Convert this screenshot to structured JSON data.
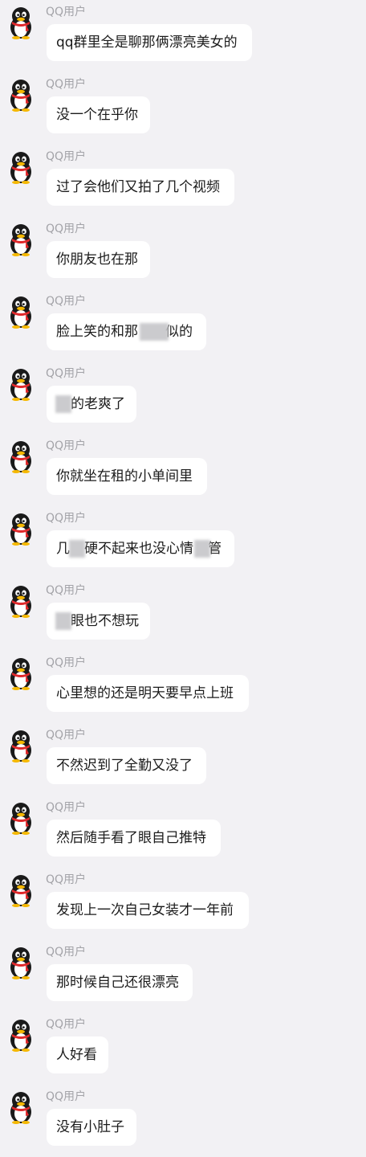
{
  "colors": {
    "background": "#f2f1f4",
    "bubble": "#ffffff",
    "sender_name": "#a3a3a8",
    "text": "#1b1b1b",
    "avatar_scarf": "#e0292b"
  },
  "avatar_icon": "qq-penguin-icon",
  "messages": [
    {
      "sender": "QQ用户",
      "text": "qq群里全是聊那俩漂亮美女的"
    },
    {
      "sender": "QQ用户",
      "text": "没一个在乎你"
    },
    {
      "sender": "QQ用户",
      "text": "过了会他们又拍了几个视频"
    },
    {
      "sender": "QQ用户",
      "text": "你朋友也在那"
    },
    {
      "sender": "QQ用户",
      "text": "脸上笑的和那似的",
      "redacted": "partially blurred"
    },
    {
      "sender": "QQ用户",
      "text": "的老爽了",
      "redacted": "partially blurred"
    },
    {
      "sender": "QQ用户",
      "text": "你就坐在租的小单间里"
    },
    {
      "sender": "QQ用户",
      "text": "几硬不起来也没心情管",
      "redacted": "partially blurred"
    },
    {
      "sender": "QQ用户",
      "text": "眼也不想玩",
      "redacted": "partially blurred"
    },
    {
      "sender": "QQ用户",
      "text": "心里想的还是明天要早点上班"
    },
    {
      "sender": "QQ用户",
      "text": "不然迟到了全勤又没了"
    },
    {
      "sender": "QQ用户",
      "text": "然后随手看了眼自己推特"
    },
    {
      "sender": "QQ用户",
      "text": "发现上一次自己女装才一年前"
    },
    {
      "sender": "QQ用户",
      "text": "那时候自己还很漂亮"
    },
    {
      "sender": "QQ用户",
      "text": "人好看"
    },
    {
      "sender": "QQ用户",
      "text": "没有小肚子"
    }
  ]
}
